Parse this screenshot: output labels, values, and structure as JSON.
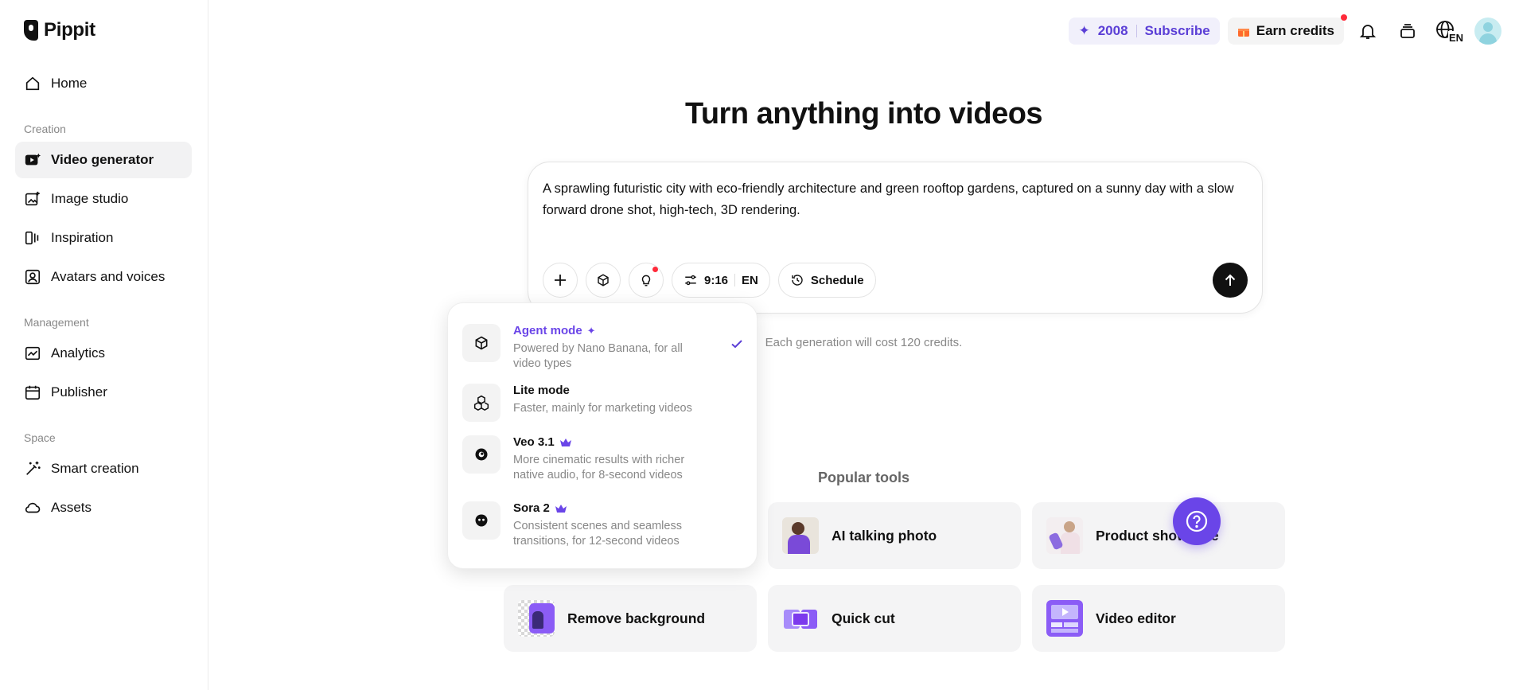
{
  "app": {
    "name": "Pippit"
  },
  "sidebar": {
    "home": "Home",
    "sections": {
      "creation": "Creation",
      "management": "Management",
      "space": "Space"
    },
    "items": {
      "video_generator": "Video generator",
      "image_studio": "Image studio",
      "inspiration": "Inspiration",
      "avatars_voices": "Avatars and voices",
      "analytics": "Analytics",
      "publisher": "Publisher",
      "smart_creation": "Smart creation",
      "assets": "Assets"
    },
    "active_item": "Video generator"
  },
  "topbar": {
    "credits": "2008",
    "subscribe": "Subscribe",
    "earn_credits": "Earn credits",
    "language": "EN",
    "accent_color": "#5b3fd6"
  },
  "main": {
    "headline": "Turn anything into videos",
    "prompt": "A sprawling futuristic city with eco-friendly architecture and green rooftop gardens, captured on a sunny day with a slow forward drone shot, high-tech, 3D rendering.",
    "aspect_ratio": "9:16",
    "language": "EN",
    "schedule": "Schedule",
    "cost_note": "Each generation will cost 120 credits."
  },
  "mode_menu": {
    "selected": "Agent mode",
    "items": [
      {
        "title": "Agent mode",
        "desc": "Powered by Nano Banana, for all video types",
        "icon": "cube-icon"
      },
      {
        "title": "Lite mode",
        "desc": "Faster, mainly for marketing videos",
        "icon": "cubes-icon"
      },
      {
        "title": "Veo 3.1",
        "desc": "More cinematic results with richer native audio, for 8-second videos",
        "icon": "veo-icon"
      },
      {
        "title": "Sora 2",
        "desc": "Consistent scenes and seamless transitions, for 12-second videos",
        "icon": "sora-icon"
      }
    ]
  },
  "popular": {
    "title": "Popular tools",
    "tools": [
      "AI talking photo",
      "Product showcase",
      "Remove background",
      "Quick cut",
      "Video editor"
    ]
  }
}
